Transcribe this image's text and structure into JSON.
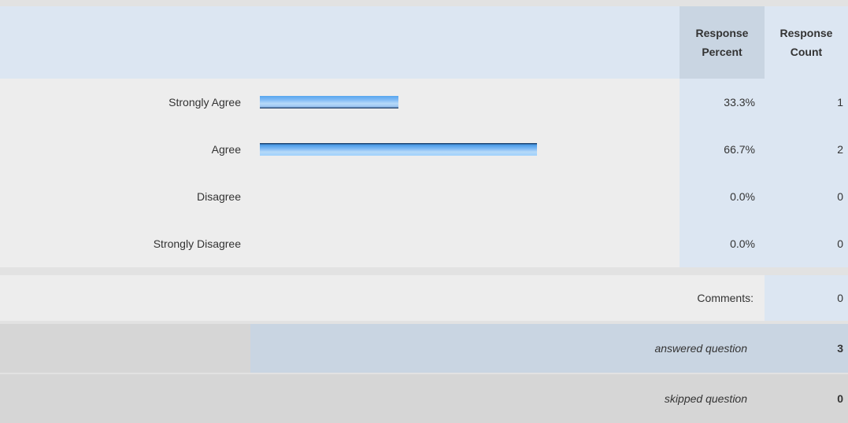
{
  "header": {
    "percent_label_1": "Response",
    "percent_label_2": "Percent",
    "count_label_1": "Response",
    "count_label_2": "Count"
  },
  "answers": [
    {
      "label": "Strongly Agree",
      "percent": "33.3%",
      "count": "1",
      "bar_fraction": 0.333
    },
    {
      "label": "Agree",
      "percent": "66.7%",
      "count": "2",
      "bar_fraction": 0.667
    },
    {
      "label": "Disagree",
      "percent": "0.0%",
      "count": "0",
      "bar_fraction": 0
    },
    {
      "label": "Strongly Disagree",
      "percent": "0.0%",
      "count": "0",
      "bar_fraction": 0
    }
  ],
  "comments": {
    "label": "Comments:",
    "count": "0"
  },
  "answered": {
    "label": "answered question",
    "count": "3"
  },
  "skipped": {
    "label": "skipped question",
    "count": "0"
  },
  "colors": {
    "header_bg": "#dce6f2",
    "header_percent_bg": "#c9d5e2",
    "row_bg": "#ededed",
    "bar_light": "#b7daf8",
    "bar_mid": "#57a6ee",
    "bar_dark": "#0d2a50"
  }
}
